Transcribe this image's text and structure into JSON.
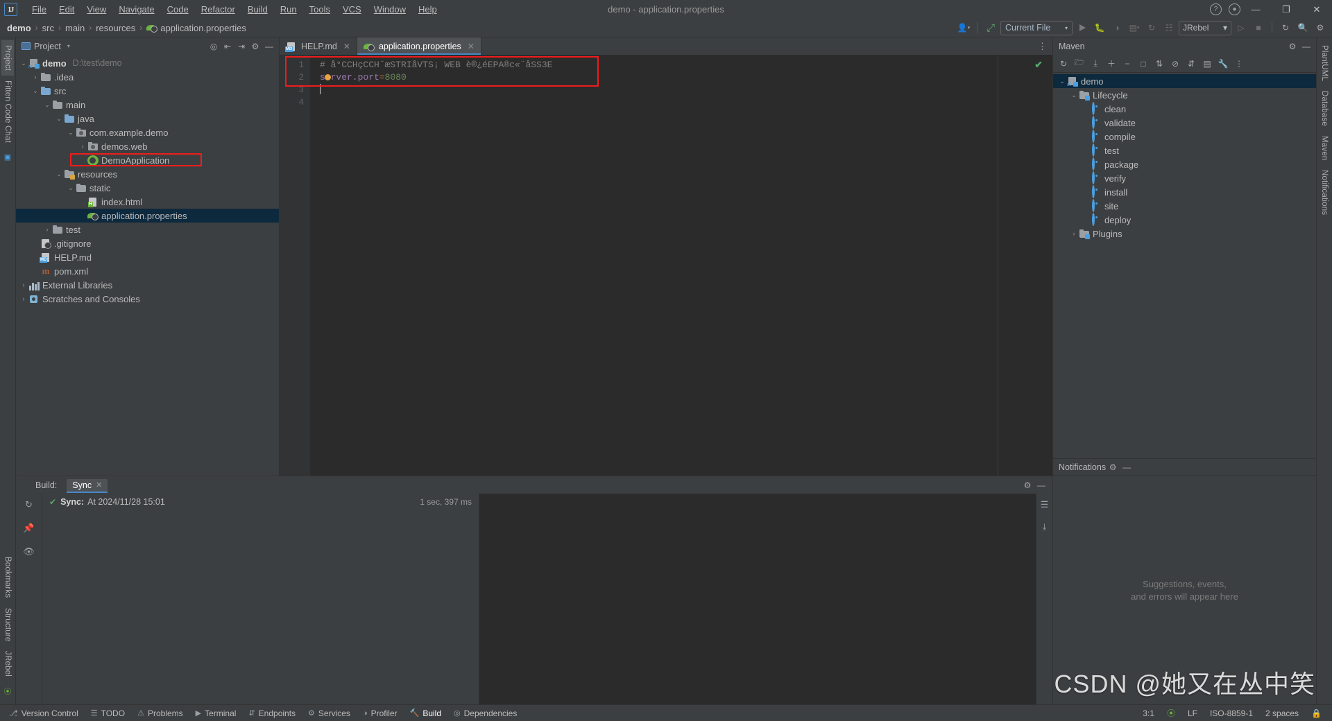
{
  "window": {
    "title": "demo - application.properties",
    "minimize": "—",
    "maximize": "❐",
    "close": "✕"
  },
  "menubar": {
    "logo": "IJ",
    "items": [
      {
        "label": "File"
      },
      {
        "label": "Edit"
      },
      {
        "label": "View"
      },
      {
        "label": "Navigate"
      },
      {
        "label": "Code"
      },
      {
        "label": "Refactor"
      },
      {
        "label": "Build"
      },
      {
        "label": "Run"
      },
      {
        "label": "Tools"
      },
      {
        "label": "VCS"
      },
      {
        "label": "Window"
      },
      {
        "label": "Help"
      }
    ]
  },
  "breadcrumb": {
    "root": "demo",
    "sep": "›",
    "parts": [
      "src",
      "main",
      "resources"
    ],
    "leaf": "application.properties"
  },
  "toolbar": {
    "run_config": "Current File",
    "jrebel": "JRebel",
    "caret": "▾",
    "icons": {
      "user": "👤",
      "hammer": "⚒",
      "run": "▶",
      "debug": "🐞",
      "profile": "◑",
      "coverage": "▦",
      "rerun": "↻",
      "stop": "■",
      "search": "🔍",
      "settings": "⚙"
    }
  },
  "left_strip": {
    "tabs": [
      "Project",
      "Fitten Code Chat"
    ],
    "bottom_tabs": [
      "Bookmarks",
      "Structure",
      "JRebel"
    ]
  },
  "right_strip": {
    "tabs": [
      "PlantUML",
      "Database",
      "Maven",
      "Notifications"
    ]
  },
  "project_panel": {
    "title": "Project",
    "caret": "▾",
    "tree": [
      {
        "indent": 0,
        "arrow": "⌄",
        "icon": "module",
        "label": "demo",
        "bold": true,
        "path": "D:\\test\\demo",
        "selected": false
      },
      {
        "indent": 1,
        "arrow": "›",
        "icon": "folder",
        "label": ".idea",
        "selected": false
      },
      {
        "indent": 1,
        "arrow": "⌄",
        "icon": "folder-src",
        "label": "src",
        "selected": false
      },
      {
        "indent": 2,
        "arrow": "⌄",
        "icon": "folder",
        "label": "main",
        "selected": false
      },
      {
        "indent": 3,
        "arrow": "⌄",
        "icon": "folder-src",
        "label": "java",
        "selected": false
      },
      {
        "indent": 4,
        "arrow": "⌄",
        "icon": "pkg",
        "label": "com.example.demo",
        "selected": false
      },
      {
        "indent": 5,
        "arrow": "›",
        "icon": "pkg",
        "label": "demos.web",
        "selected": false
      },
      {
        "indent": 5,
        "arrow": "",
        "icon": "spring",
        "label": "DemoApplication",
        "selected": false
      },
      {
        "indent": 3,
        "arrow": "⌄",
        "icon": "folder-res",
        "label": "resources",
        "selected": false
      },
      {
        "indent": 4,
        "arrow": "⌄",
        "icon": "folder",
        "label": "static",
        "selected": false
      },
      {
        "indent": 5,
        "arrow": "",
        "icon": "html",
        "label": "index.html",
        "selected": false
      },
      {
        "indent": 5,
        "arrow": "",
        "icon": "leaf",
        "label": "application.properties",
        "selected": true,
        "annotated": true
      },
      {
        "indent": 2,
        "arrow": "›",
        "icon": "folder",
        "label": "test",
        "selected": false
      },
      {
        "indent": 1,
        "arrow": "",
        "icon": "git",
        "label": ".gitignore",
        "selected": false
      },
      {
        "indent": 1,
        "arrow": "",
        "icon": "md",
        "label": "HELP.md",
        "selected": false
      },
      {
        "indent": 1,
        "arrow": "",
        "icon": "mvn",
        "label": "pom.xml",
        "selected": false
      },
      {
        "indent": 0,
        "arrow": "›",
        "icon": "libs",
        "label": "External Libraries",
        "selected": false
      },
      {
        "indent": 0,
        "arrow": "›",
        "icon": "scratch",
        "label": "Scratches and Consoles",
        "selected": false
      }
    ]
  },
  "editor": {
    "tabs": [
      {
        "label": "HELP.md",
        "icon": "md",
        "active": false,
        "close": "✕"
      },
      {
        "label": "application.properties",
        "icon": "leaf",
        "active": true,
        "close": "✕"
      }
    ],
    "more": "⋮",
    "line_numbers": [
      "1",
      "2",
      "3",
      "4"
    ],
    "lines": [
      {
        "n": 1,
        "type": "comment",
        "text": "# å°CCHçCCH¨æSTRIåVTS¡ WEB è®¿éEPA®c«¨åSS3E"
      },
      {
        "n": 2,
        "type": "code",
        "key": "server.port",
        "eq": "=",
        "value": "8080"
      },
      {
        "n": 3,
        "type": "empty",
        "text": ""
      },
      {
        "n": 4,
        "type": "empty",
        "text": ""
      }
    ],
    "inspection_ok": "✔"
  },
  "maven_panel": {
    "title": "Maven",
    "settings_icon": "⚙",
    "collapse_icon": "—",
    "toolbar_icons": [
      "↻",
      "🗁",
      "⤓",
      "＋",
      "−",
      "□",
      "⇅",
      "⊘",
      "⇵",
      "▤",
      "🔧",
      "⋮"
    ],
    "tree": [
      {
        "indent": 0,
        "arrow": "⌄",
        "icon": "module",
        "label": "demo",
        "selected": true
      },
      {
        "indent": 1,
        "arrow": "⌄",
        "icon": "folder-cfg",
        "label": "Lifecycle",
        "selected": false
      },
      {
        "indent": 2,
        "arrow": "",
        "icon": "goal",
        "label": "clean",
        "selected": false
      },
      {
        "indent": 2,
        "arrow": "",
        "icon": "goal",
        "label": "validate",
        "selected": false
      },
      {
        "indent": 2,
        "arrow": "",
        "icon": "goal",
        "label": "compile",
        "selected": false
      },
      {
        "indent": 2,
        "arrow": "",
        "icon": "goal",
        "label": "test",
        "selected": false
      },
      {
        "indent": 2,
        "arrow": "",
        "icon": "goal",
        "label": "package",
        "selected": false
      },
      {
        "indent": 2,
        "arrow": "",
        "icon": "goal",
        "label": "verify",
        "selected": false
      },
      {
        "indent": 2,
        "arrow": "",
        "icon": "goal",
        "label": "install",
        "selected": false
      },
      {
        "indent": 2,
        "arrow": "",
        "icon": "goal",
        "label": "site",
        "selected": false
      },
      {
        "indent": 2,
        "arrow": "",
        "icon": "goal",
        "label": "deploy",
        "selected": false
      },
      {
        "indent": 1,
        "arrow": "›",
        "icon": "folder-cfg",
        "label": "Plugins",
        "selected": false
      }
    ]
  },
  "notifications_panel": {
    "title": "Notifications",
    "settings_icon": "⚙",
    "collapse_icon": "—",
    "empty_line1": "Suggestions, events,",
    "empty_line2": "and errors will appear here"
  },
  "build_panel": {
    "label": "Build:",
    "tab": "Sync",
    "tab_close": "✕",
    "settings_icon": "⚙",
    "collapse_icon": "—",
    "sync_status_icon": "✔",
    "sync_title": "Sync:",
    "sync_detail": "At 2024/11/28 15:01",
    "duration": "1 sec, 397 ms",
    "side_icons": [
      "↻",
      "📌",
      "👁"
    ],
    "right_icons": [
      "☰",
      "⤓"
    ]
  },
  "statusbar": {
    "left_items": [
      {
        "icon": "⎇",
        "label": "Version Control"
      },
      {
        "icon": "☰",
        "label": "TODO"
      },
      {
        "icon": "⚠",
        "label": "Problems"
      },
      {
        "icon": "▶",
        "label": "Terminal"
      },
      {
        "icon": "⇵",
        "label": "Endpoints"
      },
      {
        "icon": "⚙",
        "label": "Services"
      },
      {
        "icon": "◑",
        "label": "Profiler"
      },
      {
        "icon": "🔨",
        "label": "Build"
      },
      {
        "icon": "◎",
        "label": "Dependencies"
      }
    ],
    "right_items": [
      {
        "label": "3:1"
      },
      {
        "label": "LF"
      },
      {
        "label": "ISO-8859-1"
      },
      {
        "label": "2 spaces"
      }
    ],
    "lock_icon": "🔒"
  },
  "watermark": "CSDN @她又在丛中笑"
}
